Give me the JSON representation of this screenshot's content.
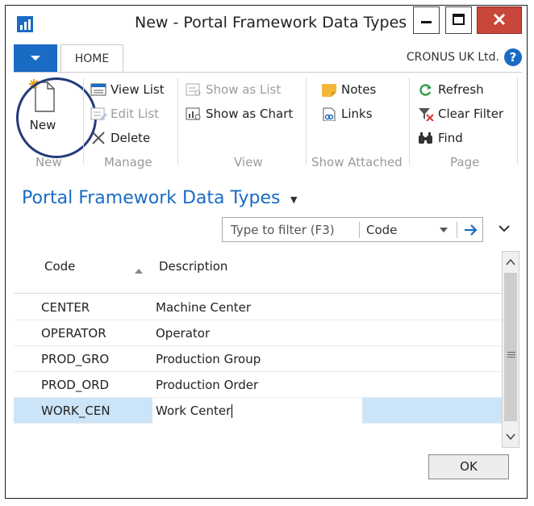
{
  "window": {
    "title": "New - Portal Framework Data Types"
  },
  "ribbon": {
    "tab_home": "HOME",
    "company": "CRONUS UK Ltd.",
    "help_symbol": "?",
    "groups": {
      "new": {
        "label": "New",
        "new_button": "New"
      },
      "manage": {
        "label": "Manage",
        "view_list": "View List",
        "edit_list": "Edit List",
        "delete": "Delete"
      },
      "view": {
        "label": "View",
        "show_as_list": "Show as List",
        "show_as_chart": "Show as Chart"
      },
      "show_attached": {
        "label": "Show Attached",
        "notes": "Notes",
        "links": "Links"
      },
      "page": {
        "label": "Page",
        "refresh": "Refresh",
        "clear_filter": "Clear Filter",
        "find": "Find"
      }
    }
  },
  "page": {
    "title": "Portal Framework Data Types"
  },
  "filter": {
    "placeholder": "Type to filter (F3)",
    "field": "Code"
  },
  "grid": {
    "columns": [
      "Code",
      "Description"
    ],
    "rows": [
      {
        "code": "CENTER",
        "description": "Machine Center"
      },
      {
        "code": "OPERATOR",
        "description": "Operator"
      },
      {
        "code": "PROD_GRO",
        "description": "Production Group"
      },
      {
        "code": "PROD_ORD",
        "description": "Production Order"
      },
      {
        "code": "WORK_CEN",
        "description": "Work Center"
      }
    ],
    "selected_row": 4
  },
  "footer": {
    "ok": "OK"
  },
  "colors": {
    "accent": "#1a6bc4",
    "close": "#c9463a",
    "selection": "#cce4f7",
    "annotation_circle": "#243a7a"
  }
}
